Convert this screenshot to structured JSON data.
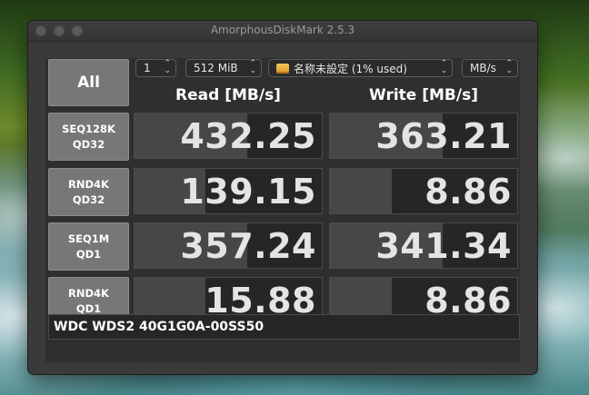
{
  "window": {
    "title": "AmorphousDiskMark 2.5.3"
  },
  "controls": {
    "all_label": "All",
    "count": "1",
    "size": "512 MiB",
    "drive": "名称未設定 (1% used)",
    "unit": "MB/s"
  },
  "columns": {
    "read": "Read [MB/s]",
    "write": "Write [MB/s]"
  },
  "tests": [
    {
      "line1": "SEQ128K",
      "line2": "QD32",
      "read": "432.25",
      "write": "363.21",
      "read_level": 0.6,
      "write_level": 0.6
    },
    {
      "line1": "RND4K",
      "line2": "QD32",
      "read": "139.15",
      "write": "8.86",
      "read_level": 0.38,
      "write_level": 0.33
    },
    {
      "line1": "SEQ1M",
      "line2": "QD1",
      "read": "357.24",
      "write": "341.34",
      "read_level": 0.6,
      "write_level": 0.6
    },
    {
      "line1": "RND4K",
      "line2": "QD1",
      "read": "15.88",
      "write": "8.86",
      "read_level": 0.38,
      "write_level": 0.33
    }
  ],
  "comment": "WDC WDS2 40G1G0A-00SS50",
  "icons": {
    "drive": "drive-icon",
    "chevrons": "chevron-updown-icon"
  }
}
